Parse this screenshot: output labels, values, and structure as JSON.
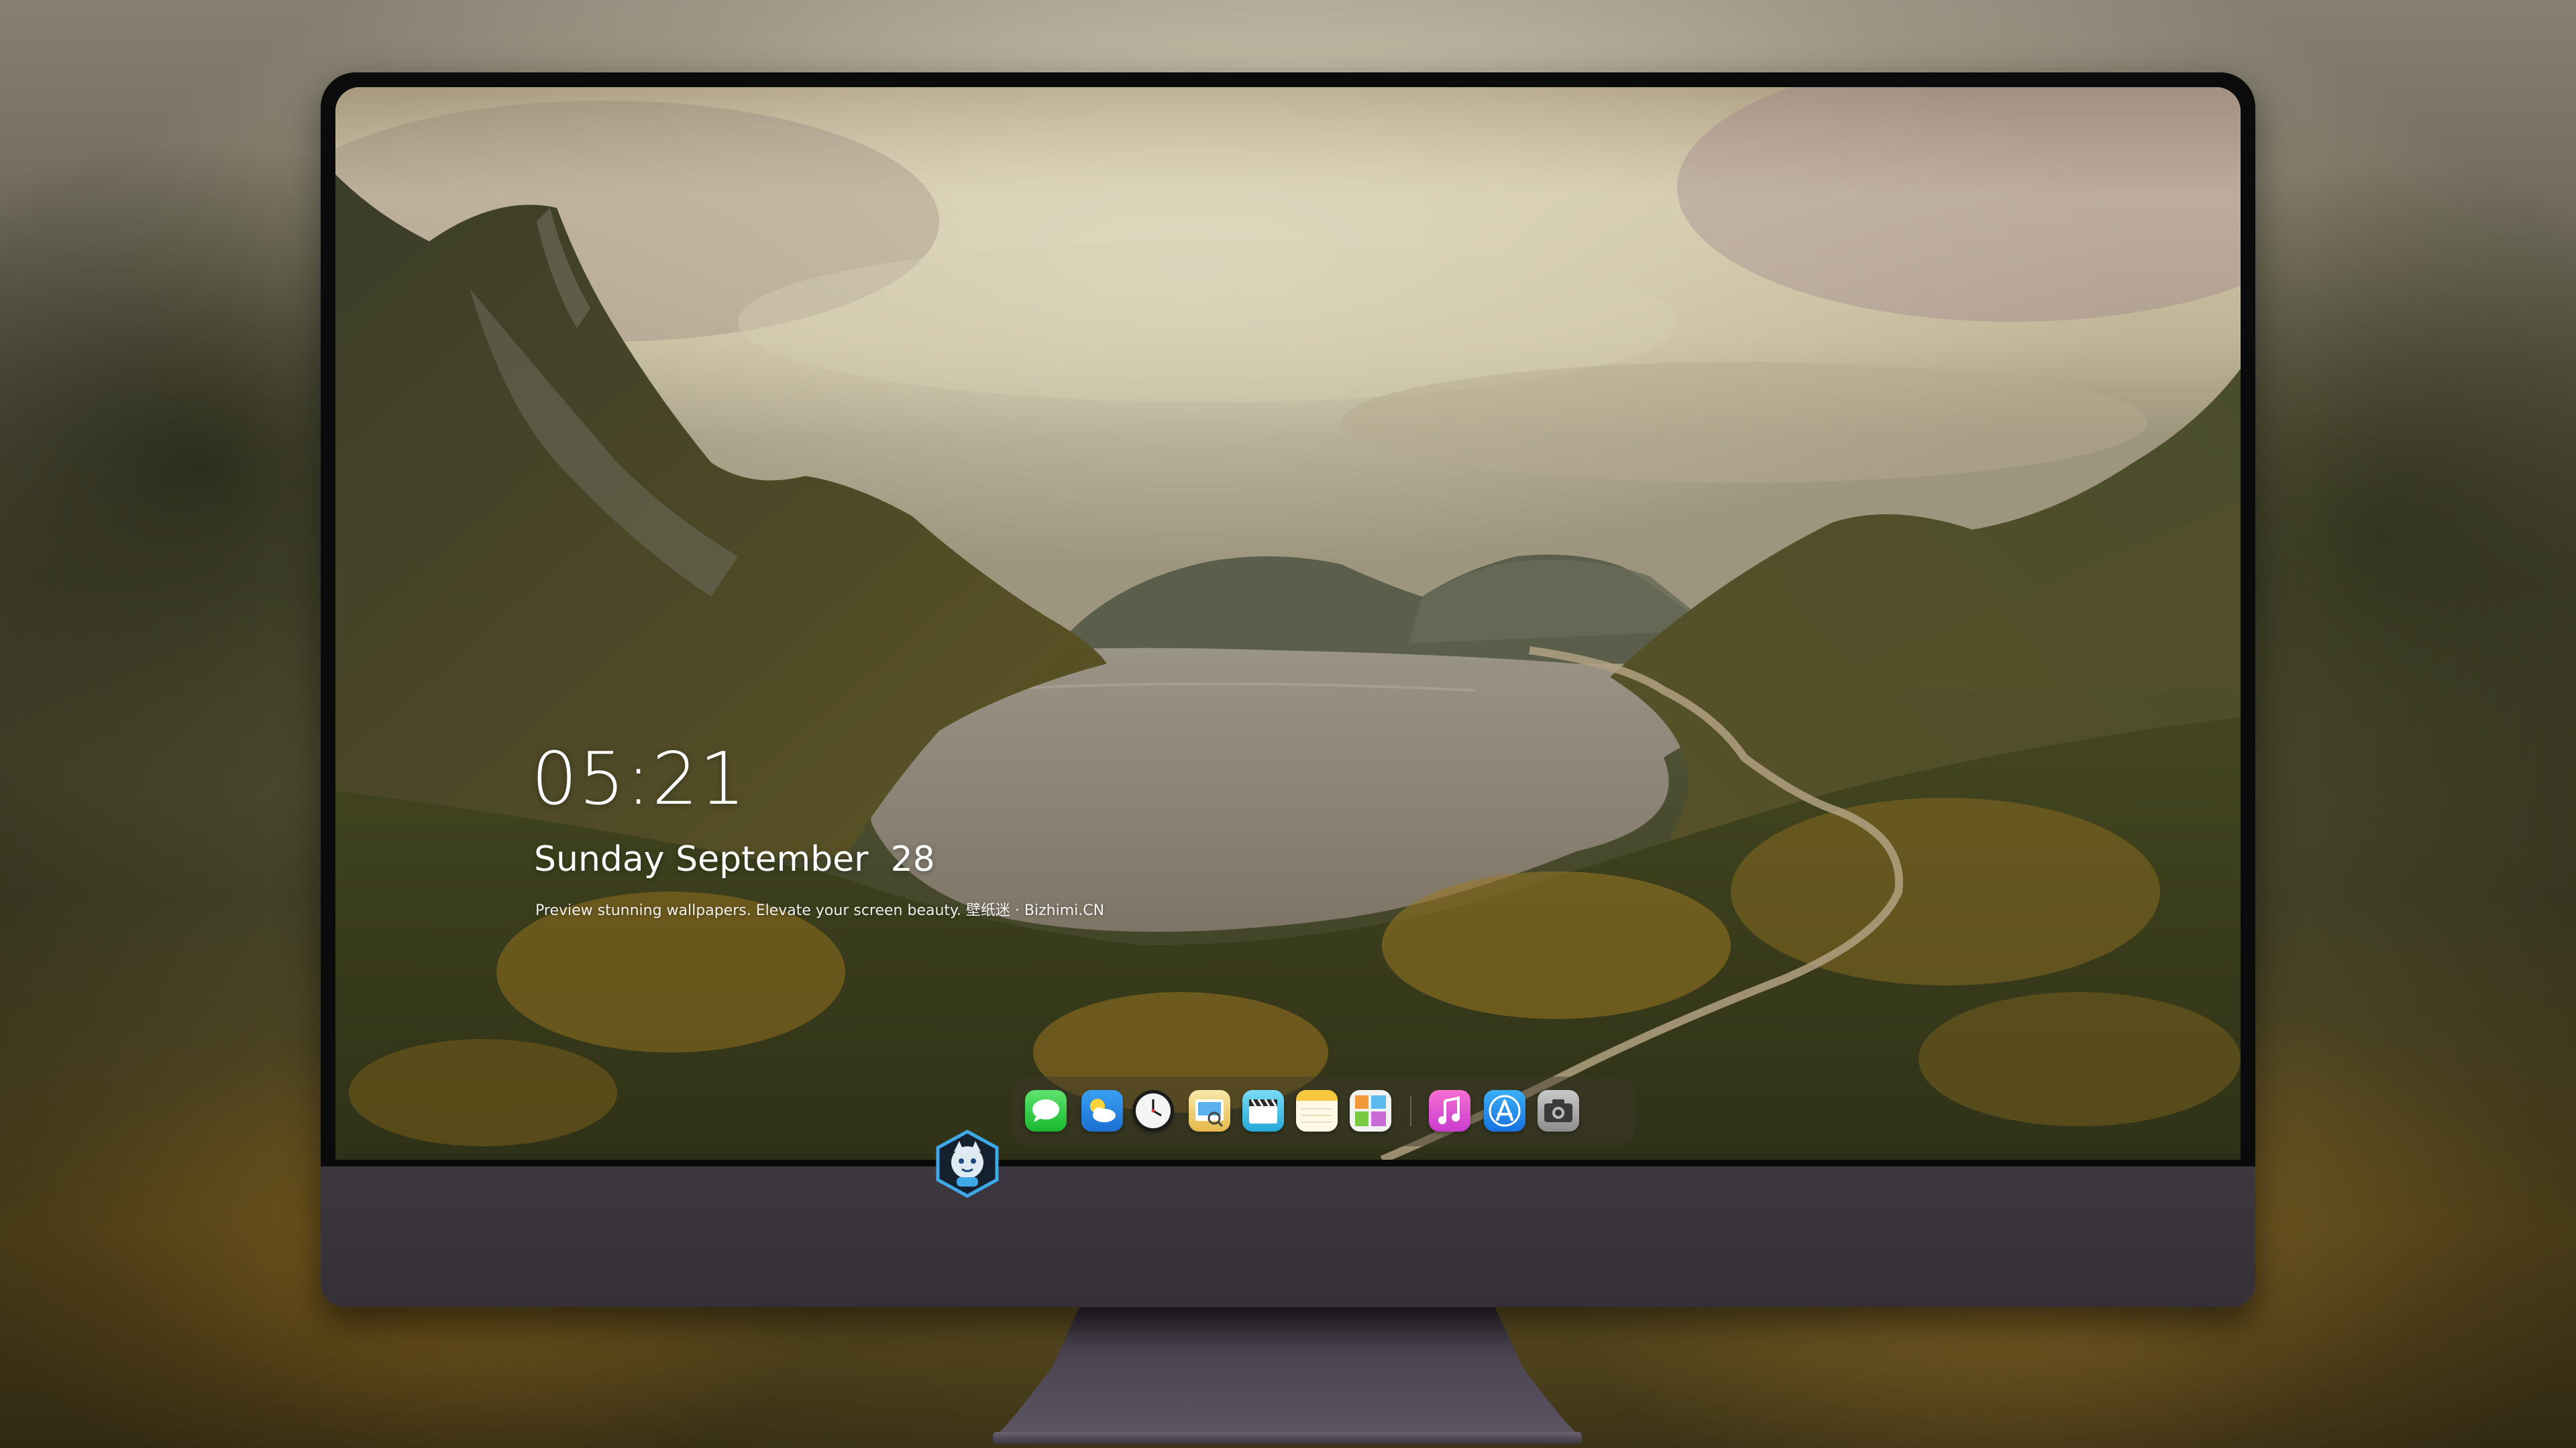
{
  "lockscreen": {
    "time": "05:21",
    "date": "Sunday September  28",
    "tagline": "Preview stunning wallpapers. Elevate your screen beauty. 壁纸迷 · Bizhimi.CN"
  },
  "dock": {
    "apps": [
      {
        "name": "messages",
        "icon": "messages-icon"
      },
      {
        "name": "weather",
        "icon": "weather-icon"
      },
      {
        "name": "clock",
        "icon": "clock-icon"
      },
      {
        "name": "preview",
        "icon": "preview-icon"
      },
      {
        "name": "clips",
        "icon": "clapperboard-icon"
      },
      {
        "name": "notes",
        "icon": "notes-icon"
      },
      {
        "name": "photo-browser",
        "icon": "photos-icon"
      },
      {
        "name": "music",
        "icon": "music-note-icon"
      },
      {
        "name": "app-store",
        "icon": "app-store-icon"
      },
      {
        "name": "camera",
        "icon": "camera-icon"
      }
    ]
  },
  "monitor": {
    "logo": "mascot-logo-icon"
  },
  "colors": {
    "bezel": "#0b0b0c",
    "chin": "#3a343c",
    "text": "#ffffff"
  }
}
